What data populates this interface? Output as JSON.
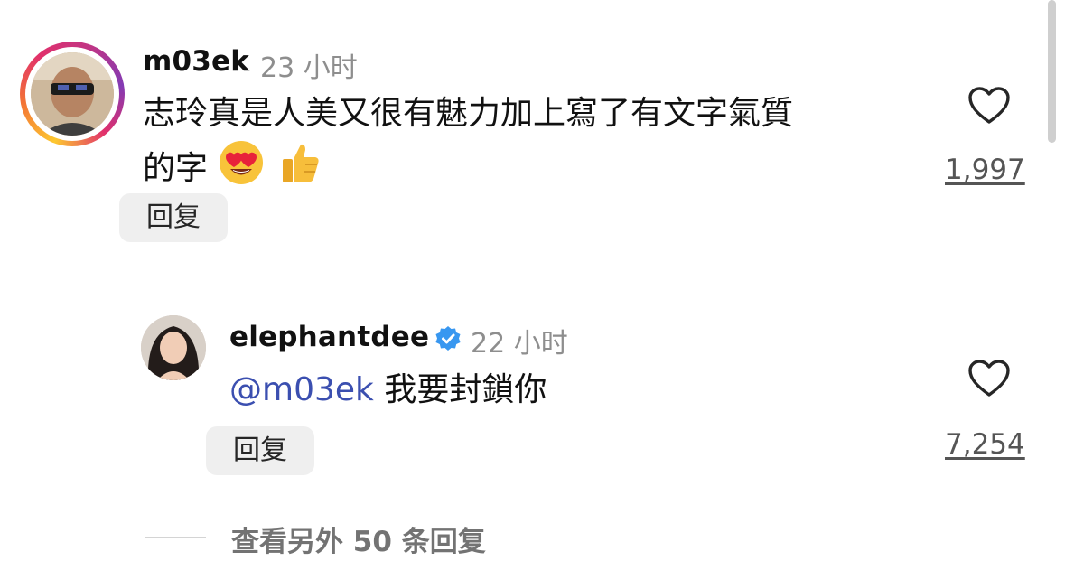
{
  "comments": [
    {
      "username": "m03ek",
      "time": "23 小时",
      "text_line1": "志玲真是人美又很有魅力加上寫了有文字氣質",
      "text_line2": "的字",
      "emojis": [
        "heart-eyes-emoji",
        "thumbs-up-emoji"
      ],
      "reply_label": "回复",
      "likes": "1,997",
      "has_story_ring": true
    }
  ],
  "replies": [
    {
      "username": "elephantdee",
      "verified": true,
      "time": "22 小时",
      "mention": "@m03ek",
      "text": "我要封鎖你",
      "reply_label": "回复",
      "likes": "7,254"
    }
  ],
  "view_more_replies": "查看另外 50 条回复",
  "colors": {
    "mention": "#3b4fb0",
    "verified_badge": "#3897f0",
    "muted_text": "#8e8e8e",
    "pill_bg": "#efefef"
  },
  "icons": [
    "heart-outline-icon",
    "verified-badge-icon"
  ]
}
